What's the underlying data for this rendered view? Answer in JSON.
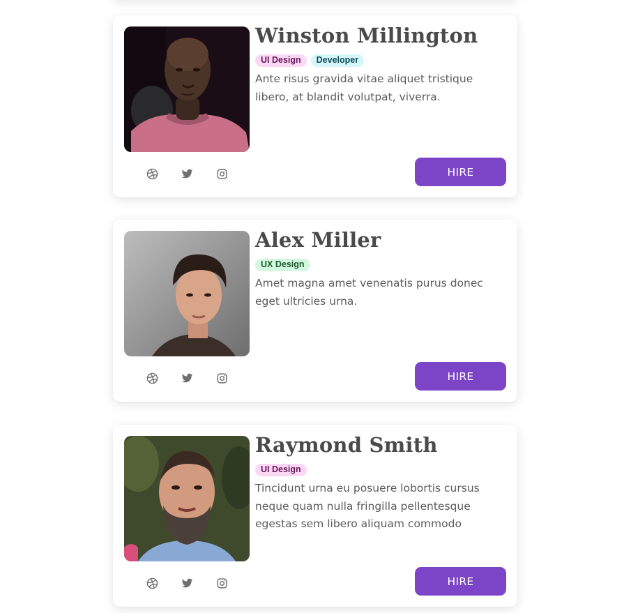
{
  "colors": {
    "accent": "#7c45c8",
    "tag_ui_design_bg": "#fbd9f5",
    "tag_ui_design_text": "#6b1659",
    "tag_developer_bg": "#d5f6fa",
    "tag_developer_text": "#0e4f5a",
    "tag_ux_design_bg": "#d4f7df",
    "tag_ux_design_text": "#1a5c2e",
    "social_icon": "#6f6f6f"
  },
  "profiles": [
    {
      "name": "Winston Millington",
      "photo": "portrait-winston",
      "tags": [
        {
          "label": "UI Design",
          "kind": "ui-design"
        },
        {
          "label": "Developer",
          "kind": "developer"
        }
      ],
      "description": "Ante risus gravida vitae aliquet tristique libero, at blandit volutpat, viverra.",
      "socials": [
        "dribbble-icon",
        "twitter-icon",
        "instagram-icon"
      ],
      "hire_label": "HIRE"
    },
    {
      "name": "Alex Miller",
      "photo": "portrait-alex",
      "tags": [
        {
          "label": "UX Design",
          "kind": "ux-design"
        }
      ],
      "description": "Amet magna amet venenatis purus donec eget ultricies urna.",
      "socials": [
        "dribbble-icon",
        "twitter-icon",
        "instagram-icon"
      ],
      "hire_label": "HIRE"
    },
    {
      "name": "Raymond Smith",
      "photo": "portrait-raymond",
      "tags": [
        {
          "label": "UI Design",
          "kind": "ui-design"
        }
      ],
      "description": "Tincidunt urna eu posuere lobortis cursus neque quam nulla fringilla pellentesque egestas sem libero aliquam commodo",
      "socials": [
        "dribbble-icon",
        "twitter-icon",
        "instagram-icon"
      ],
      "hire_label": "HIRE"
    }
  ]
}
